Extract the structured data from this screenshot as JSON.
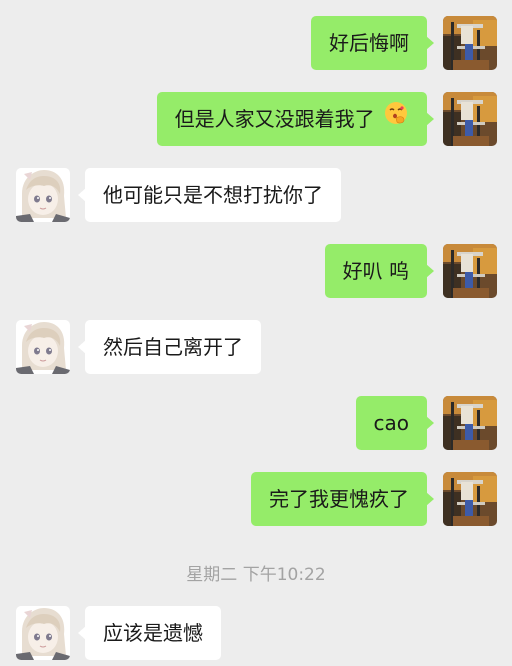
{
  "messages": [
    {
      "side": "right",
      "text": "好后悔啊"
    },
    {
      "side": "right",
      "text": "但是人家又没跟着我了",
      "emoji": "kissing-face-with-hand-emoji"
    },
    {
      "side": "left",
      "text": "他可能只是不想打扰你了"
    },
    {
      "side": "right",
      "text": "好叭 呜"
    },
    {
      "side": "left",
      "text": "然后自己离开了"
    },
    {
      "side": "right",
      "text": "cao"
    },
    {
      "side": "right",
      "text": "完了我更愧疚了"
    },
    {
      "side": "left",
      "text": "应该是遗憾"
    }
  ],
  "timestamp": "星期二 下午10:22",
  "colors": {
    "background": "#ededed",
    "self_bubble": "#95ec69",
    "other_bubble": "#ffffff",
    "timestamp_text": "#a3a3a3"
  },
  "icons": {
    "self_avatar": "photo-avatar-icon",
    "other_avatar": "anime-girl-avatar-icon"
  }
}
